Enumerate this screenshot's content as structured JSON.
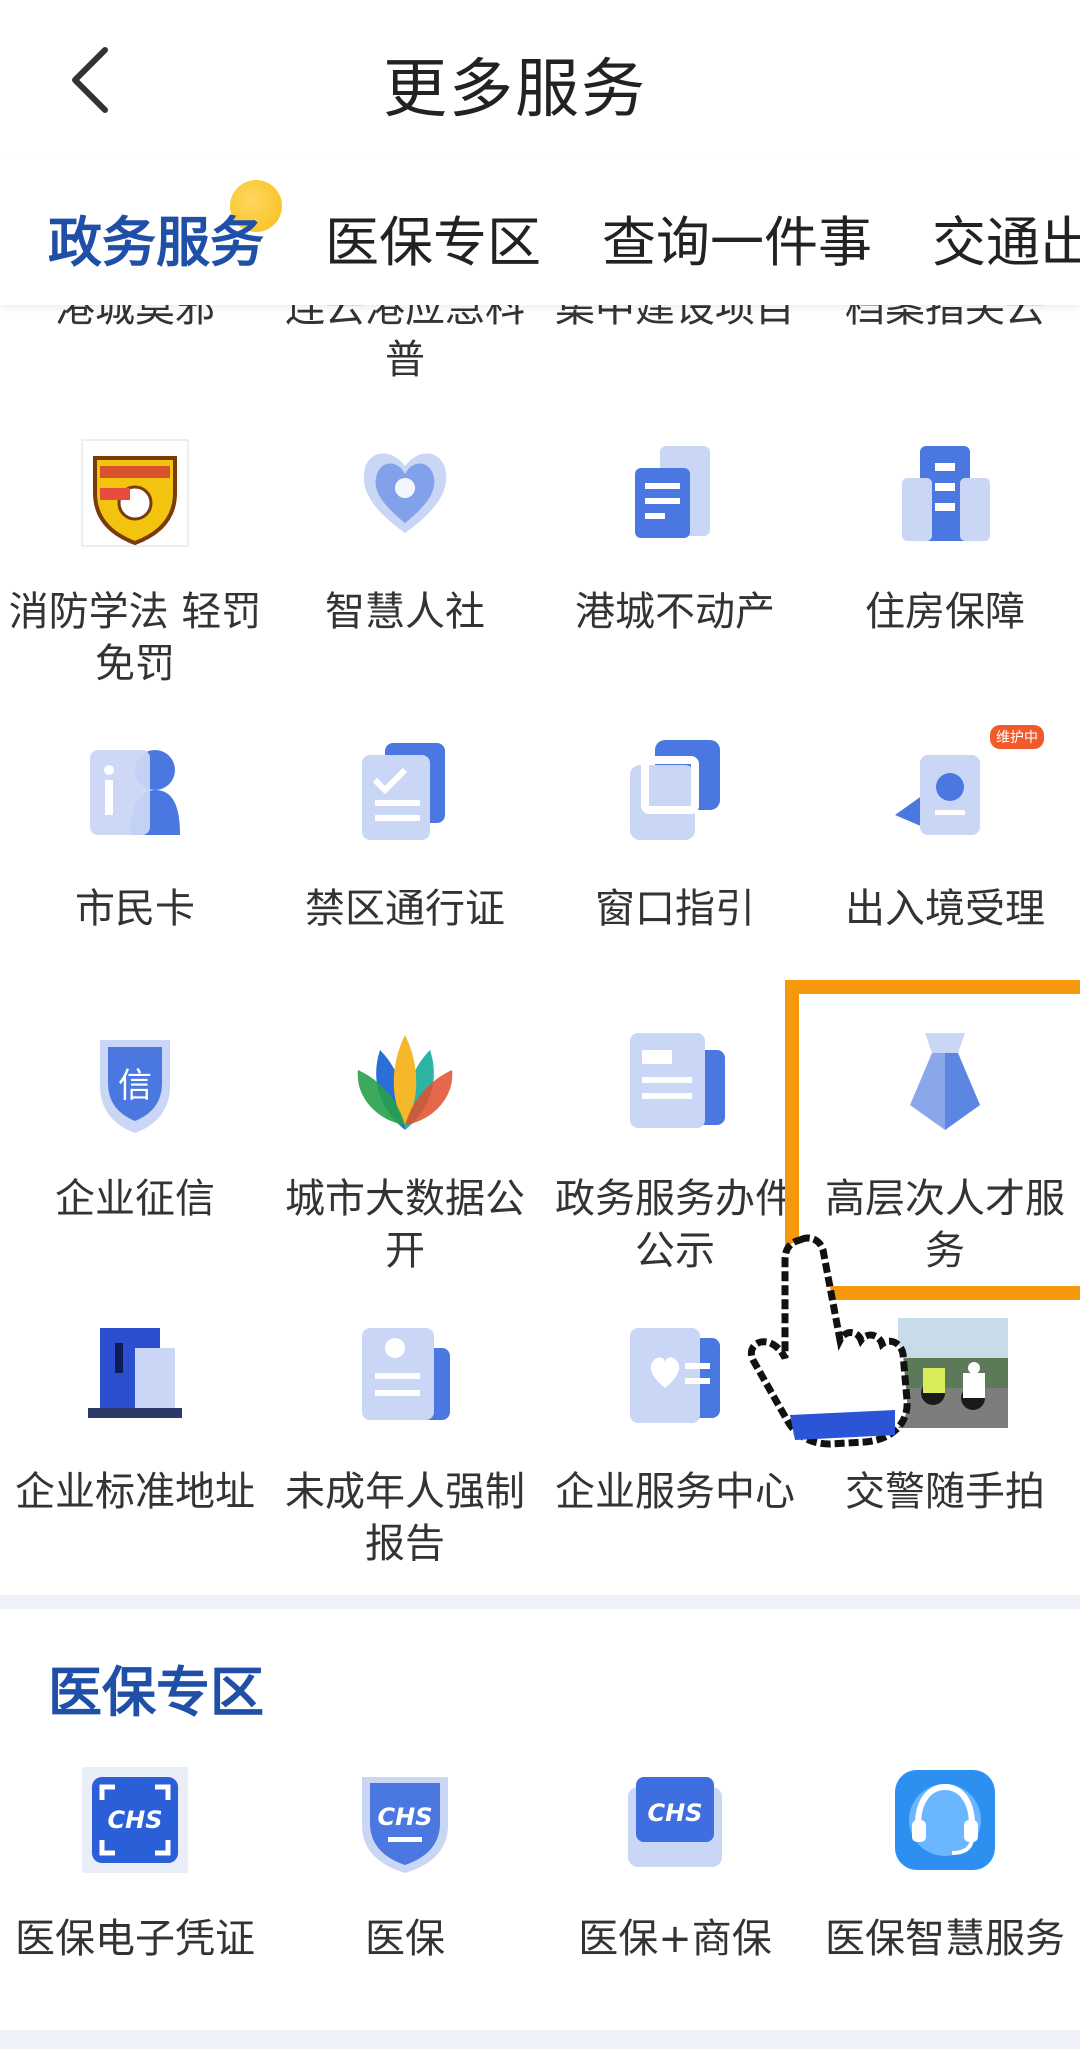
{
  "header": {
    "title": "更多服务"
  },
  "tabs": [
    {
      "label": "政务服务",
      "active": true
    },
    {
      "label": "医保专区",
      "active": false
    },
    {
      "label": "查询一件事",
      "active": false
    },
    {
      "label": "交通出",
      "active": false
    }
  ],
  "cut_row": [
    "港城莫邪",
    "连云港应急科\n普",
    "集中建设项目",
    "档案指尖云"
  ],
  "services": [
    {
      "label": "消防学法 轻罚\n免罚",
      "icon": "fire-safety-logo"
    },
    {
      "label": "智慧人社",
      "icon": "heart-hands-icon"
    },
    {
      "label": "港城不动产",
      "icon": "building-doc-icon"
    },
    {
      "label": "住房保障",
      "icon": "apartment-icon"
    },
    {
      "label": "市民卡",
      "icon": "citizen-card-icon"
    },
    {
      "label": "禁区通行证",
      "icon": "permit-doc-icon"
    },
    {
      "label": "窗口指引",
      "icon": "window-icon"
    },
    {
      "label": "出入境受理",
      "icon": "passport-icon",
      "badge": "维护中"
    },
    {
      "label": "企业征信",
      "icon": "credit-shield-icon",
      "shield_text": "信"
    },
    {
      "label": "城市大数据公\n开",
      "icon": "lotus-logo"
    },
    {
      "label": "政务服务办件\n公示",
      "icon": "notice-doc-icon"
    },
    {
      "label": "高层次人才服\n务",
      "icon": "tie-icon"
    },
    {
      "label": "企业标准地址",
      "icon": "address-building-icon"
    },
    {
      "label": "未成年人强制\n报告",
      "icon": "report-doc-icon"
    },
    {
      "label": "企业服务中心",
      "icon": "enterprise-heart-icon"
    },
    {
      "label": "交警随手拍",
      "icon": "traffic-police-photo"
    }
  ],
  "medical_section": {
    "title": "医保专区",
    "items": [
      {
        "label": "医保电子凭证",
        "icon": "chs-scan-icon",
        "logo_text": "CHS"
      },
      {
        "label": "医保",
        "icon": "chs-shield-icon",
        "logo_text": "CHS"
      },
      {
        "label": "医保+商保",
        "icon": "chs-card-icon",
        "logo_text": "CHS"
      },
      {
        "label": "医保智慧服务",
        "icon": "headset-icon"
      }
    ]
  },
  "colors": {
    "accent": "#1f4fa6",
    "highlight": "#f7980c",
    "icon_blue": "#4a78e0",
    "icon_light": "#c9d6f5"
  }
}
